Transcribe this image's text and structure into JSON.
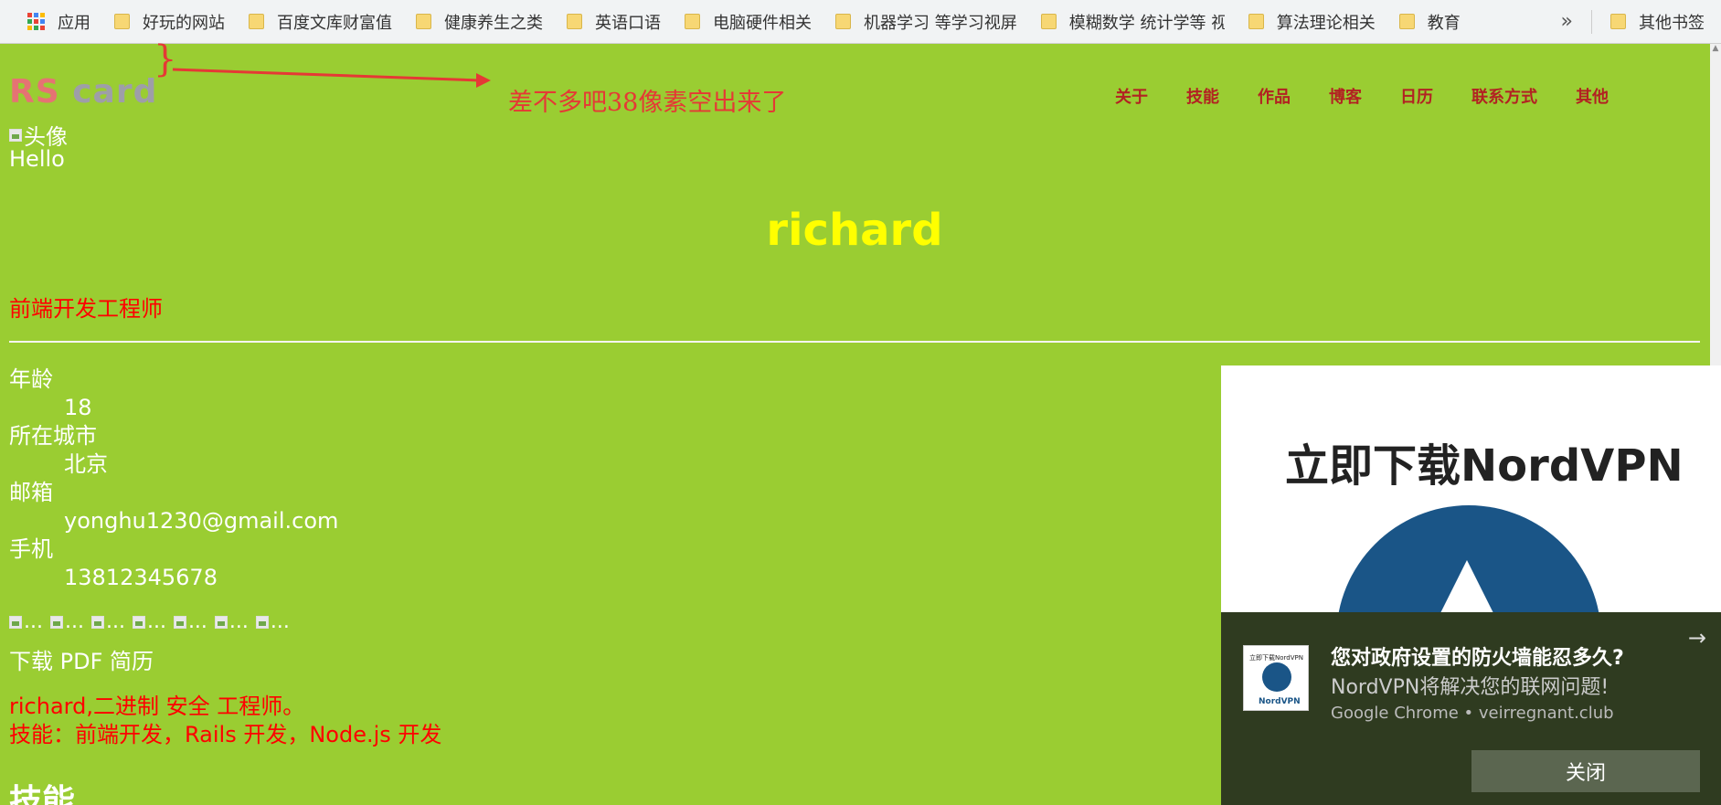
{
  "bookmarks": {
    "apps_label": "应用",
    "items": [
      "好玩的网站",
      "百度文库财富值",
      "健康养生之类",
      "英语口语",
      "电脑硬件相关",
      "机器学习 等学习视屏",
      "模糊数学 统计学等 视",
      "算法理论相关",
      "教育"
    ],
    "more": "»",
    "other": "其他书签"
  },
  "page": {
    "logo_rs": "RS",
    "logo_card": "card",
    "annotation_brace": "}",
    "annotation_note": "差不多吧38像素空出来了",
    "nav": [
      "关于",
      "技能",
      "作品",
      "博客",
      "日历",
      "联系方式",
      "其他"
    ],
    "avatar_alt": "头像",
    "hello": "Hello",
    "name": "richard",
    "job": "前端开发工程师",
    "info": [
      {
        "label": "年龄",
        "value": "18"
      },
      {
        "label": "所在城市",
        "value": "北京"
      },
      {
        "label": "邮箱",
        "value": "yonghu1230@gmail.com"
      },
      {
        "label": "手机",
        "value": "13812345678"
      }
    ],
    "icon_alt": "...",
    "pdf": "下载 PDF 简历",
    "intro_line1": "richard,二进制 安全 工程师。",
    "intro_line2": "技能：前端开发，Rails 开发，Node.js 开发",
    "skills_heading": "技能"
  },
  "ad": {
    "title": "立即下载NordVPN",
    "thumb_title": "立即下载NordVPN",
    "thumb_brand": "NordVPN"
  },
  "toast": {
    "title": "您对政府设置的防火墙能忍多久?",
    "body": "NordVPN将解决您的联网问题!",
    "source": "Google Chrome • veirregnant.club",
    "close": "关闭",
    "arrow": "→"
  }
}
